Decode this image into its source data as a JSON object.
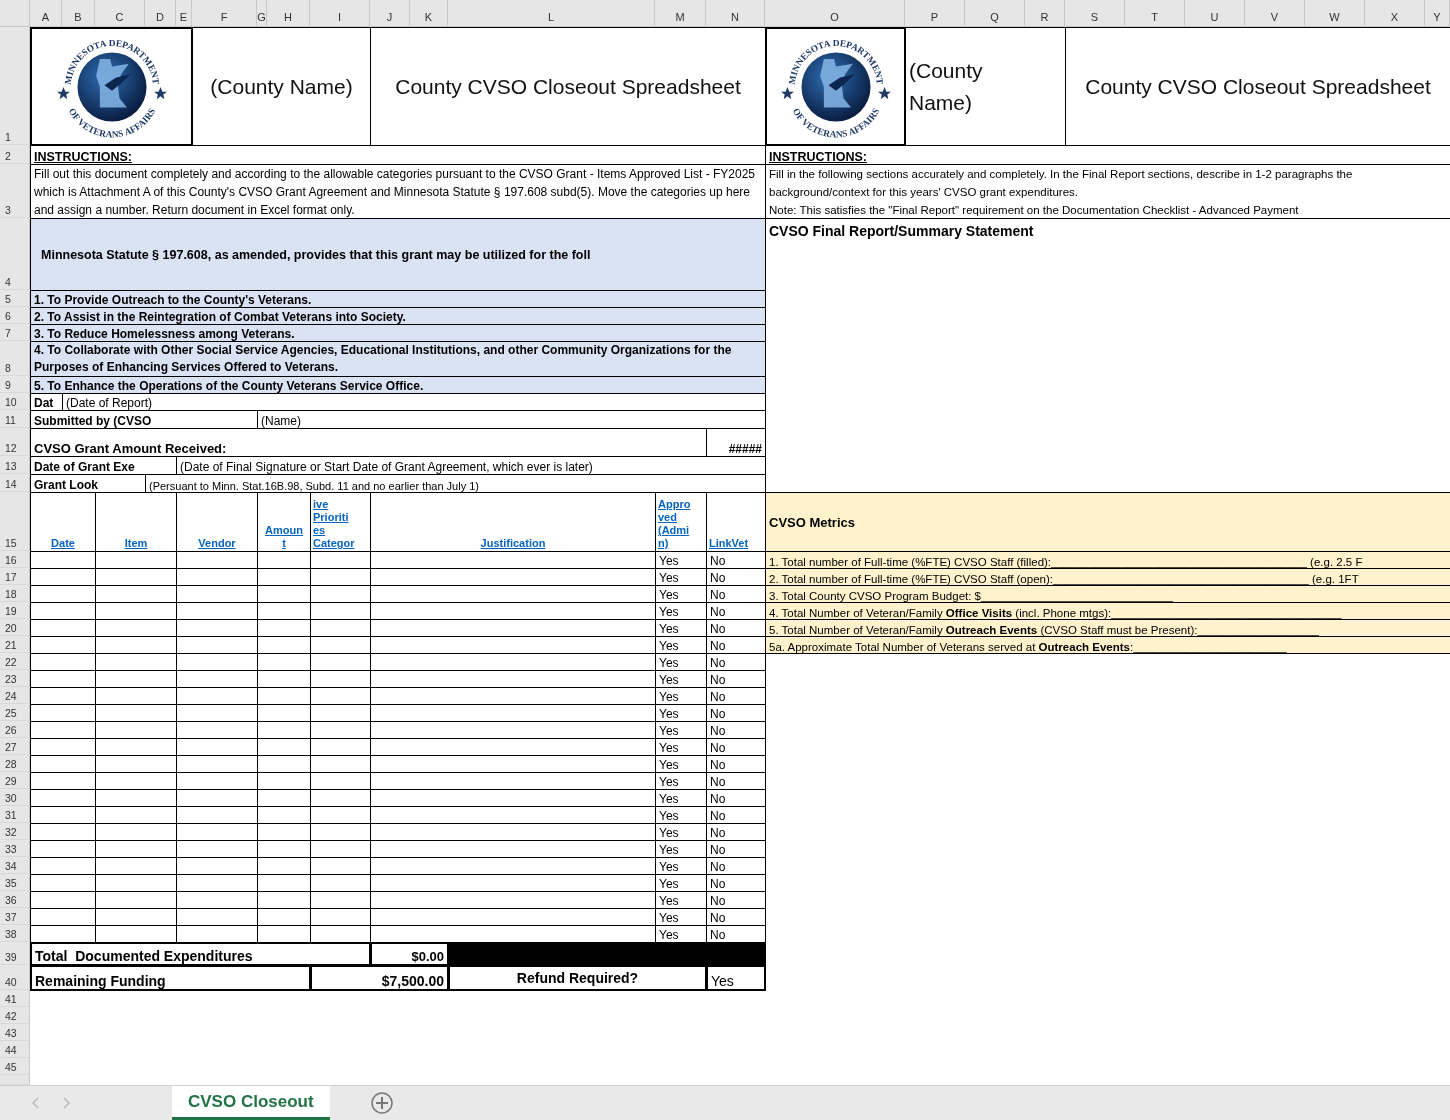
{
  "column_headers": [
    "A",
    "B",
    "C",
    "D",
    "E",
    "F",
    "G",
    "H",
    "I",
    "J",
    "K",
    "L",
    "M",
    "N",
    "O",
    "P",
    "Q",
    "R",
    "S",
    "T",
    "U",
    "V",
    "W",
    "X",
    "Y"
  ],
  "row_numbers": [
    "1",
    "2",
    "3",
    "4",
    "5",
    "6",
    "7",
    "8",
    "9",
    "10",
    "11",
    "12",
    "13",
    "14",
    "15",
    "16",
    "17",
    "18",
    "19",
    "20",
    "21",
    "22",
    "23",
    "24",
    "25",
    "26",
    "27",
    "28",
    "29",
    "30",
    "31",
    "32",
    "33",
    "34",
    "35",
    "36",
    "37",
    "38",
    "39",
    "40",
    "41",
    "42",
    "43",
    "44",
    "45"
  ],
  "left_panel": {
    "seal_text": [
      "MINNESOTA DEPARTMENT",
      "OF VETERANS AFFAIRS"
    ],
    "county_name": "(County Name)",
    "title": "County CVSO Closeout Spreadsheet",
    "instructions_heading": "INSTRUCTIONS:",
    "instructions": "Fill out this document completely and according to the allowable categories pursuant to the CVSO Grant - Items Approved List - FY2025 which is Attachment A of this County's CVSO Grant Agreement and Minnesota Statute § 197.608 subd(5).  Move the categories up here and assign a number.  Return document in Excel format only.",
    "statute": "Minnesota Statute § 197.608, as amended, provides that this grant may be utilized for the foll",
    "purposes": [
      "1. To Provide Outreach to the County's Veterans.",
      "2. To Assist in the Reintegration of Combat Veterans into Society.",
      "3. To Reduce Homelessness among Veterans.",
      "4. To Collaborate with Other Social Service Agencies, Educational Institutions, and other Community Organizations for the Purposes of Enhancing Services Offered to Veterans.",
      "5. To Enhance the Operations of the County Veterans Service Office."
    ],
    "report_date": {
      "label": "Dat",
      "hint": "(Date of Report)"
    },
    "submitted_by": {
      "label": "Submitted by (CVSO",
      "hint": "(Name)"
    },
    "grant_amount": {
      "label": "CVSO Grant Amount Received:",
      "value": "#####"
    },
    "execution_date": {
      "label": "Date of Grant Exe",
      "hint": "(Date of Final Signature or Start Date of Grant Agreement, which ever is later)"
    },
    "lookback": {
      "label": "Grant Look",
      "hint": "(Persuant to Minn. Stat.16B.98, Subd. 11 and no earlier than July 1)"
    }
  },
  "expense_table": {
    "columns": [
      {
        "lines": [
          "Date"
        ]
      },
      {
        "lines": [
          "Item"
        ]
      },
      {
        "lines": [
          "Vendor"
        ]
      },
      {
        "lines": [
          "Amoun",
          "t"
        ]
      },
      {
        "lines": [
          "ive",
          "Prioriti",
          "es",
          "Categor"
        ]
      },
      {
        "lines": [
          "Justification"
        ]
      },
      {
        "lines": [
          "Appro",
          "ved",
          "(Admi",
          "n)"
        ]
      },
      {
        "lines": [
          "LinkVet"
        ]
      }
    ],
    "rows": [
      {
        "approved": "Yes",
        "linkvet": "No"
      },
      {
        "approved": "Yes",
        "linkvet": "No"
      },
      {
        "approved": "Yes",
        "linkvet": "No"
      },
      {
        "approved": "Yes",
        "linkvet": "No"
      },
      {
        "approved": "Yes",
        "linkvet": "No"
      },
      {
        "approved": "Yes",
        "linkvet": "No"
      },
      {
        "approved": "Yes",
        "linkvet": "No"
      },
      {
        "approved": "Yes",
        "linkvet": "No"
      },
      {
        "approved": "Yes",
        "linkvet": "No"
      },
      {
        "approved": "Yes",
        "linkvet": "No"
      },
      {
        "approved": "Yes",
        "linkvet": "No"
      },
      {
        "approved": "Yes",
        "linkvet": "No"
      },
      {
        "approved": "Yes",
        "linkvet": "No"
      },
      {
        "approved": "Yes",
        "linkvet": "No"
      },
      {
        "approved": "Yes",
        "linkvet": "No"
      },
      {
        "approved": "Yes",
        "linkvet": "No"
      },
      {
        "approved": "Yes",
        "linkvet": "No"
      },
      {
        "approved": "Yes",
        "linkvet": "No"
      },
      {
        "approved": "Yes",
        "linkvet": "No"
      },
      {
        "approved": "Yes",
        "linkvet": "No"
      },
      {
        "approved": "Yes",
        "linkvet": "No"
      },
      {
        "approved": "Yes",
        "linkvet": "No"
      },
      {
        "approved": "Yes",
        "linkvet": "No"
      }
    ]
  },
  "totals": {
    "documented_label": "Total  Documented Expenditures",
    "documented_value": "$0.00",
    "remaining_label": "Remaining Funding",
    "remaining_value": "$7,500.00",
    "refund_label": "Refund Required?",
    "refund_value": "Yes"
  },
  "right_panel": {
    "seal_text": [
      "MINNESOTA DEPARTMENT",
      "OF VETERANS AFFAIRS"
    ],
    "county_name": "(County Name)",
    "title": "County CVSO Closeout Spreadsheet",
    "instructions_heading": "INSTRUCTIONS:",
    "instructions": [
      "Fill in the following sections accurately and completely.  In the Final Report sections, describe in 1-2 paragraphs the background/context for this years' CVSO grant expenditures.",
      "Note: This satisfies the \"Final Report\" requirement on the Documentation Checklist - Advanced Payment"
    ],
    "final_report_heading": "CVSO Final Report/Summary Statement",
    "metrics_heading": "CVSO Metrics",
    "metrics": [
      "1. Total number of Full-time (%FTE) CVSO Staff (filled):________________________________________ (e.g. 2.5 F",
      "2. Total number of Full-time (%FTE) CVSO Staff (open):________________________________________ (e.g. 1FT",
      "3. Total County CVSO Program Budget: $______________________________",
      "4. Total Number of Veteran/Family **Office Visits** (incl. Phone mtgs):____________________________________",
      "5. Total Number of Veteran/Family **Outreach Events** (CVSO Staff must be Present):___________________",
      "5a. Approximate Total Number of Veterans served at **Outreach Events**:________________________"
    ]
  },
  "sheet_tabs": [
    {
      "label": "CVSO Closeout",
      "selected": true
    }
  ]
}
